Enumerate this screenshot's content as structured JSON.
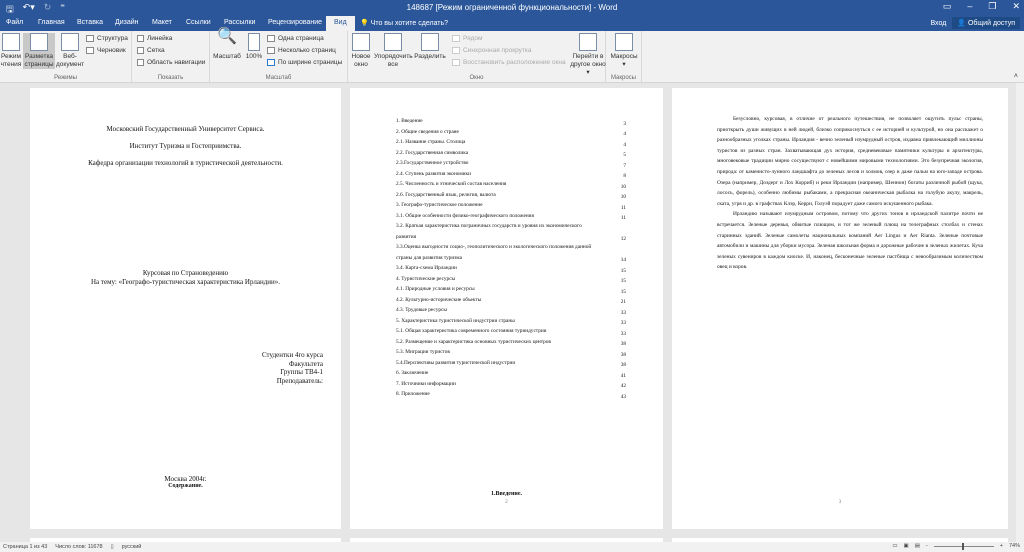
{
  "app": {
    "title": "148687 [Режим ограниченной функциональности] - Word",
    "signin": "Вход",
    "share": "Общий доступ"
  },
  "tabs": [
    "Файл",
    "Главная",
    "Вставка",
    "Дизайн",
    "Макет",
    "Ссылки",
    "Рассылки",
    "Рецензирование",
    "Вид"
  ],
  "tell_me": "Что вы хотите сделать?",
  "ribbon": {
    "modes": {
      "label": "Режимы",
      "read": "Режим чтения",
      "layout": "Разметка страницы",
      "web": "Веб-документ",
      "outline": "Структура",
      "draft": "Черновик"
    },
    "show": {
      "label": "Показать",
      "ruler": "Линейка",
      "grid": "Сетка",
      "nav": "Область навигации"
    },
    "zoom": {
      "label": "Масштаб",
      "zoom": "Масштаб",
      "p100": "100%",
      "one": "Одна страница",
      "multi": "Несколько страниц",
      "width": "По ширине страницы"
    },
    "window": {
      "label": "Окно",
      "new": "Новое окно",
      "arrange": "Упорядочить все",
      "split": "Разделить",
      "side": "Рядом",
      "sync": "Синхронная прокрутка",
      "reset": "Восстановить расположение окна",
      "switch": "Перейти в другое окно"
    },
    "macros": {
      "label": "Макросы",
      "macros": "Макросы"
    }
  },
  "page1": {
    "l1": "Московский Государственный Университет Сервиса.",
    "l2": "Институт Туризма и Гостеприимства.",
    "l3": "Кафедра организации технологий в туристической деятельности.",
    "c1": "Курсовая по Страноведению",
    "c2": "На тему: «Географо-туристическая характеристика Ирландии».",
    "s1": "Студентки 4го курса",
    "s2": "Факультета",
    "s3": "Группы ТВ4-1",
    "s4": "Преподаватель:",
    "city": "Москва 2004г.",
    "footer": "Содержание."
  },
  "page2": {
    "toc": [
      {
        "t": "1. Введение",
        "p": "3"
      },
      {
        "t": "2. Общие сведения о стране",
        "p": "4"
      },
      {
        "t": "2.1. Название страны. Столица",
        "p": "4"
      },
      {
        "t": "2.2. Государственная символика",
        "p": "5"
      },
      {
        "t": "2.3.Государственное устройство",
        "p": "7"
      },
      {
        "t": "2.4. Ступень развития экономики",
        "p": "8"
      },
      {
        "t": "2.5. Численность и этнический состав населения",
        "p": "10"
      },
      {
        "t": "2.6. Государственный язык, религия, валюта",
        "p": "10"
      },
      {
        "t": "3. Географо-туристическое положение",
        "p": "11"
      },
      {
        "t": "3.1. Общие особенности физико-географического положения",
        "p": "11"
      },
      {
        "t": "3.2. Краткая характеристика пограничных государств и уровня их экономического развития",
        "p": "12"
      },
      {
        "t": "3.3.Оценка выгодности социо-, геополитического и экологического положения данной страны для развития туризма",
        "p": "14"
      },
      {
        "t": "3.4. Карта-схема Ирландии",
        "p": "15"
      },
      {
        "t": "4. Туристические ресурсы",
        "p": "15"
      },
      {
        "t": "4.1. Природные условия и ресурсы",
        "p": "15"
      },
      {
        "t": "4.2. Культурно-исторические объекты",
        "p": "21"
      },
      {
        "t": "4.3. Трудовые ресурсы",
        "p": "33"
      },
      {
        "t": "5. Характеристика туристической индустрии страны",
        "p": "33"
      },
      {
        "t": "5.1. Общая характеристика современного состояния туриндустрии",
        "p": "33"
      },
      {
        "t": "5.2. Размещение и характеристика основных туристических центров",
        "p": "38"
      },
      {
        "t": "5.3. Миграции туристов",
        "p": "38"
      },
      {
        "t": "5.4.Перспективы развития туристической индустрии",
        "p": "38"
      },
      {
        "t": "6. Заключение",
        "p": "41"
      },
      {
        "t": "7. Источники информации",
        "p": "42"
      },
      {
        "t": "8. Приложение",
        "p": "43"
      }
    ],
    "footer": "1.Введение.",
    "num": "2"
  },
  "page3": {
    "p1": "Безусловно, курсовая, в отличие от реального путешествия, не позволяет ощутить пульс страны, приоткрыть души живущих в ней людей, близко соприкоснуться с ее историей и культурой, но она расскажет о разнообразных уголках страны. Ирландия - вечно зеленый изумрудный остров, издавна привлекающий миллионы туристов из разных стран. Захватывающая дух история, средневековые памятники культуры и архитектуры, многовековые традиции мирно сосуществуют с новейшими мировыми технологиями. Это безупречная экология, природа: от каменисто-лунного ландшафта до зеленых лесов и холмов, озер и даже пальм на юго-западе острова. Озера (например, Доэдерг и Лох Корриб) и реки Ирландии (например, Шеннон) богаты различной рыбой (щука, лосось, форель), особенно любимы рыбаками, а прекрасная океаническая рыбалка на голубую акулу, макрель, ската, угря и др. в графствах Клэр, Керри, Голуэй порадует даже самого искушенного рыбака.",
    "p2": "Ирландию называют изумрудным островом, потому что других тонов в ирландской палитре почти не встречается. Зеленые деревья, обвитые плющом, и тот же зеленый плющ на телеграфных столбах и стенах старинных зданий. Зеленые самолеты национальных компаний Aer Lingus и Aer Rianta. Зеленые почтовые автомобили и машины для уборки мусора. Зеленая школьная форма и дорожные рабочие в зеленых жилетах. Куча зеленых сувениров в каждом киоске. И, наконец, бесконечные зеленые пастбища с невообразимым количеством овец и коров.",
    "num": "3"
  },
  "status": {
    "page": "Страница 1 из 43",
    "words": "Число слов: 11678",
    "lang": "русский",
    "zoom": "74%"
  }
}
